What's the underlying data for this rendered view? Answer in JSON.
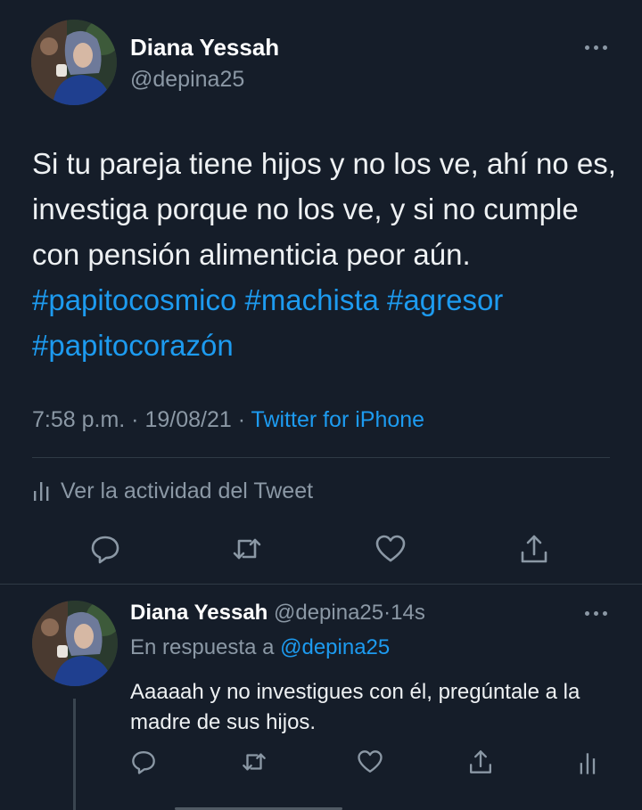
{
  "main_tweet": {
    "author_name": "Diana Yessah",
    "author_handle": "@depina25",
    "text_plain": "Si tu pareja tiene hijos y no los ve, ahí no es, investiga porque no los ve, y si no cumple con pensión alimenticia peor aún. ",
    "hashtags": [
      "#papitocosmico",
      "#machista",
      "#agresor",
      "#papitocorazón"
    ],
    "time": "7:58 p.m.",
    "separator": " · ",
    "date": "19/08/21",
    "source": "Twitter for iPhone",
    "activity_label": "Ver la actividad del Tweet",
    "icons": {
      "reply": "reply-icon",
      "retweet": "retweet-icon",
      "like": "heart-icon",
      "share": "share-icon",
      "more": "more-dots-icon",
      "activity": "analytics-icon"
    }
  },
  "reply_tweet": {
    "author_name": "Diana Yessah",
    "author_handle": "@depina25",
    "time_ago": "14s",
    "separator": "·",
    "in_reply_to_label": "En respuesta a ",
    "in_reply_to_handle": "@depina25",
    "text": "Aaaaah y no investigues con él, pregúntale a la madre de sus hijos."
  },
  "colors": {
    "background": "#151d29",
    "text": "#eef1f3",
    "secondary": "#8b98a5",
    "accent": "#1d9bf0",
    "divider": "#2f3a45"
  }
}
